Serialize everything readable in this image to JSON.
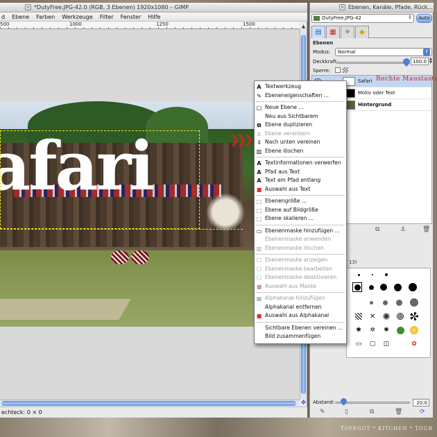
{
  "image_window": {
    "title": "*DutyFree.JPG-42.0 (RGB, 3 Ebenen) 1920x1080 – GIMP",
    "menu": [
      "d",
      "Ebene",
      "Farben",
      "Werkzeuge",
      "Filter",
      "Fenster",
      "Hilfe"
    ],
    "ruler_ticks": [
      "500",
      "1000",
      "1250",
      "1500"
    ],
    "canvas_text": "afari",
    "status": "echteck: 0 × 0"
  },
  "dock": {
    "title": "Ebenen, Kanäle, Pfade, Rück...",
    "image_name": "DutyFree.JPG-42",
    "auto_label": "Auto",
    "panel_title": "Ebenen",
    "mode_label": "Modus:",
    "mode_value": "Normal",
    "opacity_label": "Deckkraft:",
    "opacity_value": "100.0",
    "opacity_fraction": 1.0,
    "lock_label": "Sperre:",
    "layers": [
      {
        "name": "Safari",
        "selected": true,
        "bold": false
      },
      {
        "name": "Motiv oder Text",
        "selected": false,
        "bold": false
      },
      {
        "name": "Hintergrund",
        "selected": false,
        "bold": true
      }
    ],
    "annotation": "Rechte Maustaste",
    "brush_header": "13)",
    "spacing_label": "Abstand:",
    "spacing_value": "20.0"
  },
  "context_menu": {
    "items": [
      {
        "label": "Textwerkzeug",
        "icon": "A",
        "disabled": false
      },
      {
        "label": "Ebeneneigenschaften ...",
        "icon": "✎",
        "disabled": false
      },
      {
        "sep": true
      },
      {
        "label": "Neue Ebene ...",
        "icon": "□",
        "disabled": false
      },
      {
        "label": "Neu aus Sichtbarem",
        "icon": "",
        "disabled": false
      },
      {
        "label": "Ebene duplizieren",
        "icon": "⧉",
        "disabled": false
      },
      {
        "label": "Ebene verankern",
        "icon": "⚓",
        "disabled": true
      },
      {
        "label": "Nach unten vereinen",
        "icon": "⇩",
        "disabled": false
      },
      {
        "label": "Ebene löschen",
        "icon": "▥",
        "disabled": false
      },
      {
        "sep": true
      },
      {
        "label": "Textinformationen verwerfen",
        "icon": "A",
        "disabled": false
      },
      {
        "label": "Pfad aus Text",
        "icon": "A",
        "disabled": false
      },
      {
        "label": "Text am Pfad entlang",
        "icon": "A",
        "disabled": false
      },
      {
        "label": "Auswahl aus Text",
        "icon": "■",
        "disabled": false
      },
      {
        "sep": true
      },
      {
        "label": "Ebenengröße ...",
        "icon": "⬚",
        "disabled": false
      },
      {
        "label": "Ebene auf Bildgröße",
        "icon": "⬚",
        "disabled": false
      },
      {
        "label": "Ebene skalieren ...",
        "icon": "⬚",
        "disabled": false
      },
      {
        "sep": true
      },
      {
        "label": "Ebenenmaske hinzufügen ...",
        "icon": "▭",
        "disabled": false
      },
      {
        "label": "Ebenenmaske anwenden",
        "icon": "",
        "disabled": true
      },
      {
        "label": "Ebenenmaske löschen",
        "icon": "▥",
        "disabled": true
      },
      {
        "sep": true
      },
      {
        "label": "Ebenenmaske anzeigen",
        "icon": "☐",
        "disabled": true
      },
      {
        "label": "Ebenenmaske bearbeiten",
        "icon": "☐",
        "disabled": true
      },
      {
        "label": "Ebenenmaske deaktivieren",
        "icon": "☐",
        "disabled": true
      },
      {
        "label": "Auswahl aus Maske",
        "icon": "■",
        "disabled": true
      },
      {
        "sep": true
      },
      {
        "label": "Alphakanal hinzufügen",
        "icon": "▦",
        "disabled": true
      },
      {
        "label": "Alphakanal entfernen",
        "icon": "",
        "disabled": false
      },
      {
        "label": "Auswahl aus Alphakanal",
        "icon": "■",
        "disabled": false
      },
      {
        "sep": true
      },
      {
        "label": "Sichtbare Ebenen vereinen ...",
        "icon": "",
        "disabled": false
      },
      {
        "label": "Bild zusammenfügen",
        "icon": "",
        "disabled": false
      }
    ]
  },
  "watermark": "TOPFGUT * KITCHEN * TOUR",
  "colors": {
    "accent_blue": "#4d7fd4",
    "annotation_red": "#c8281d",
    "selected_layer": "#c2d6f2"
  }
}
